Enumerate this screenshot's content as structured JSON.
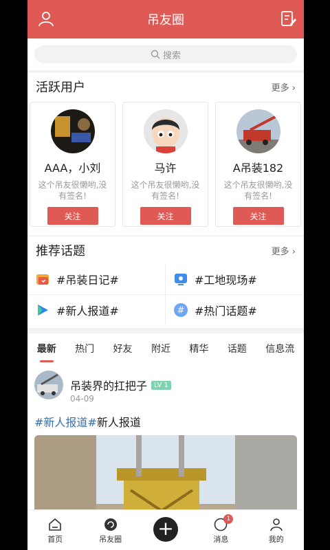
{
  "header": {
    "title": "吊友圈"
  },
  "search": {
    "placeholder": "搜索"
  },
  "active_users": {
    "title": "活跃用户",
    "more": "更多",
    "users": [
      {
        "name": "AAA，小刘",
        "signature": "这个吊友很懒哟,没有签名!",
        "follow": "关注"
      },
      {
        "name": "马许",
        "signature": "这个吊友很懒哟,没有签名!",
        "follow": "关注"
      },
      {
        "name": "A吊装182",
        "signature": "这个吊友很懒哟,没有签名!",
        "follow": "关注"
      }
    ]
  },
  "topics": {
    "title": "推荐话题",
    "more": "更多",
    "items": [
      "#吊装日记#",
      "#工地现场#",
      "#新人报道#",
      "#热门话题#"
    ]
  },
  "feed_tabs": [
    "最新",
    "热门",
    "好友",
    "附近",
    "精华",
    "话题",
    "信息流"
  ],
  "post": {
    "author": "吊装界的扛把子",
    "level": "LV 1",
    "date": "04-09",
    "hashtag": "#新人报道#",
    "text": "新人报道"
  },
  "bottom_nav": {
    "home": "首页",
    "circle": "吊友圈",
    "plus": "+",
    "messages": "消息",
    "messages_badge": "1",
    "mine": "我的"
  },
  "colors": {
    "accent": "#e05a55",
    "hashtag": "#3b6ea5"
  }
}
